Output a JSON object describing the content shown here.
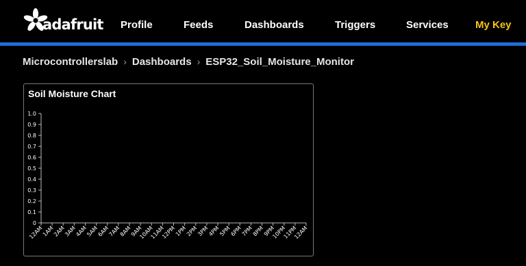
{
  "logo": {
    "text": "adafruit"
  },
  "nav": {
    "items": [
      {
        "label": "Profile"
      },
      {
        "label": "Feeds"
      },
      {
        "label": "Dashboards"
      },
      {
        "label": "Triggers"
      },
      {
        "label": "Services"
      },
      {
        "label": "My Key",
        "accent": "#f6c31c"
      }
    ]
  },
  "breadcrumb": {
    "items": [
      "Microcontrollerslab",
      "Dashboards",
      "ESP32_Soil_Moisture_Monitor"
    ],
    "separator": "›"
  },
  "colors": {
    "accent_blue": "#1e6ed8",
    "accent_yellow": "#f6c31c",
    "background": "#000000"
  },
  "chart_data": {
    "type": "line",
    "title": "Soil Moisture Chart",
    "xlabel": "",
    "ylabel": "",
    "ylim": [
      0,
      1.0
    ],
    "yticks": [
      "1.0",
      "0.9",
      "0.8",
      "0.7",
      "0.6",
      "0.5",
      "0.4",
      "0.3",
      "0.2",
      "0.1",
      "0"
    ],
    "categories": [
      "12AM",
      "1AM",
      "2AM",
      "3AM",
      "4AM",
      "5AM",
      "6AM",
      "7AM",
      "8AM",
      "9AM",
      "10AM",
      "11AM",
      "12PM",
      "1PM",
      "2PM",
      "3PM",
      "4PM",
      "5PM",
      "6PM",
      "7PM",
      "8PM",
      "9PM",
      "10PM",
      "11PM",
      "12AM"
    ],
    "series": [],
    "grid": false
  }
}
